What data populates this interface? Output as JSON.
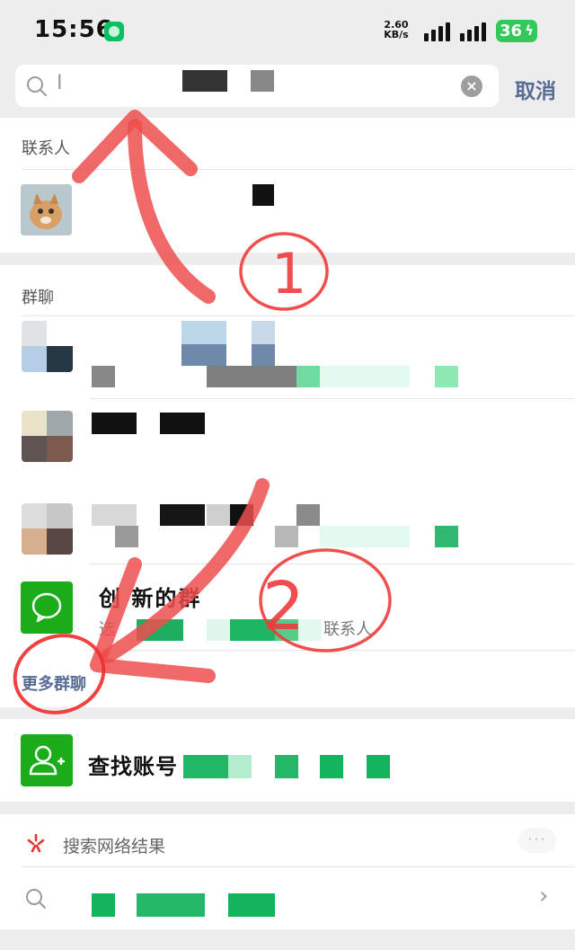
{
  "status_bar": {
    "time": "15:56",
    "net_speed_value": "2.60",
    "net_speed_unit": "KB/s",
    "battery": "36"
  },
  "search": {
    "cancel_label": "取消",
    "query_visible": "I"
  },
  "contacts": {
    "section_title": "联系人"
  },
  "groups": {
    "section_title": "群聊",
    "create_title": "创  新的群",
    "create_subtitle": "选",
    "create_subtitle_end": "联系人",
    "more_label": "更多群聊"
  },
  "find_account": {
    "label": "查找账号"
  },
  "web_search": {
    "label": "搜索网络结果",
    "more_dots": "···"
  },
  "annotations": {
    "mark_1": "1",
    "mark_2": "2"
  },
  "colors": {
    "accent_link": "#576b95",
    "wechat_green": "#07c160",
    "annotation_red": "#ef4d4d"
  },
  "icons": [
    "search-icon",
    "clear-icon",
    "chat-bubble-icon",
    "add-contact-icon",
    "search-web-icon",
    "chevron-right-icon"
  ]
}
